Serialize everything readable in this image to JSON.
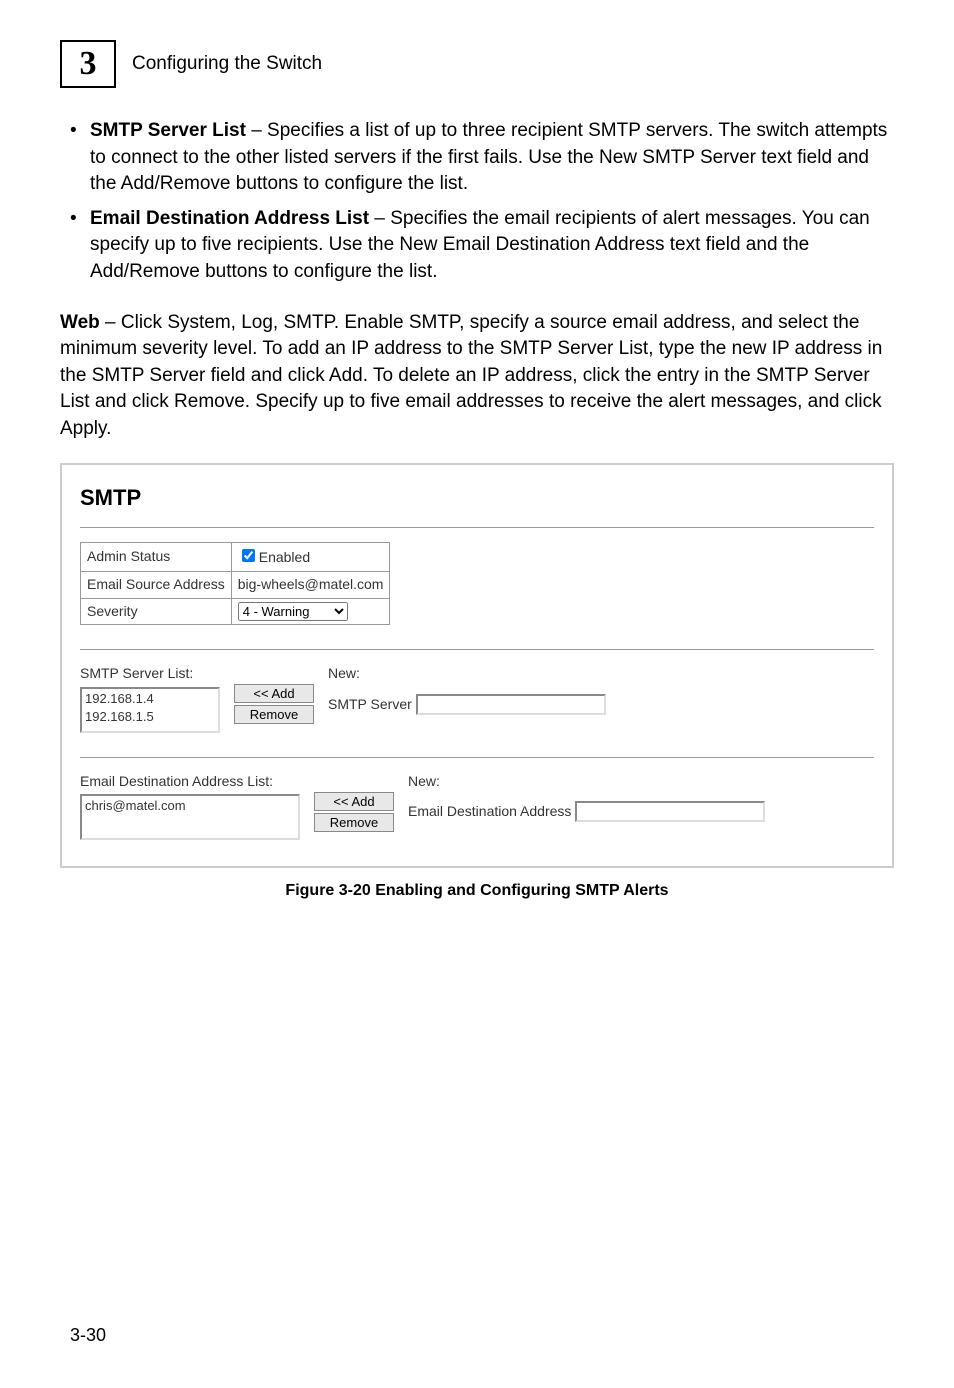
{
  "header": {
    "chapter_number": "3",
    "title": "Configuring the Switch"
  },
  "bullets": [
    {
      "term": "SMTP Server List",
      "text": " – Specifies a list of up to three recipient SMTP servers. The switch attempts to connect to the other listed servers if the first fails. Use the New SMTP Server text field and the Add/Remove buttons to configure the list."
    },
    {
      "term": "Email Destination Address List",
      "text": " – Specifies the email recipients of alert messages. You can specify up to five recipients. Use the New Email Destination Address text field and the Add/Remove buttons to configure the list."
    }
  ],
  "web_para": {
    "lead": "Web",
    "text": " – Click System, Log, SMTP. Enable SMTP, specify a source email address, and select the minimum severity level. To add an IP address to the SMTP Server List, type the new IP address in the SMTP Server field and click Add. To delete an IP address, click the entry in the SMTP Server List and click Remove. Specify up to five email addresses to receive the alert messages, and click Apply."
  },
  "smtp_panel": {
    "title": "SMTP",
    "rows": {
      "admin_status_label": "Admin Status",
      "admin_status_value": "Enabled",
      "email_source_label": "Email Source Address",
      "email_source_value": "big-wheels@matel.com",
      "severity_label": "Severity",
      "severity_value": "4 - Warning"
    },
    "smtp_server_list": {
      "label": "SMTP Server List:",
      "items": [
        "192.168.1.4",
        "192.168.1.5"
      ],
      "new_label": "New:",
      "input_label": "SMTP Server",
      "add_btn": "<< Add",
      "remove_btn": "Remove"
    },
    "email_dest_list": {
      "label": "Email Destination Address List:",
      "items": [
        "chris@matel.com"
      ],
      "new_label": "New:",
      "input_label": "Email Destination Address",
      "add_btn": "<< Add",
      "remove_btn": "Remove"
    }
  },
  "figure_caption": "Figure 3-20   Enabling and Configuring SMTP Alerts",
  "page_number": "3-30"
}
